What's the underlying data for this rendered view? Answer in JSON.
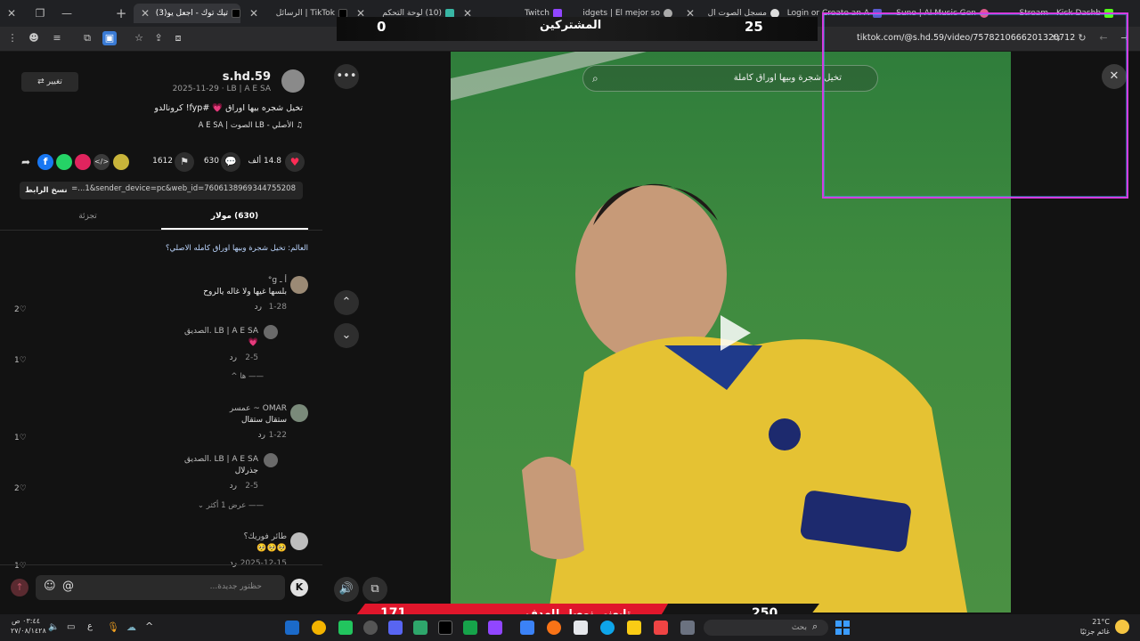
{
  "browser": {
    "tabs": [
      {
        "label": "تيك توك - اجعل يو(3)",
        "active": true
      },
      {
        "label": "TikTok | الرسائل"
      },
      {
        "label": "(10) لوحة التحكم"
      },
      {
        "label": "Twitch"
      },
      {
        "label": "Widgets | El mejor so"
      },
      {
        "label": "مسجل الصوت ال"
      },
      {
        "label": "Login or Create an A"
      },
      {
        "label": "Suno | AI Music Gen"
      },
      {
        "label": "Stream - Kick Dashb"
      }
    ],
    "url": "tiktok.com/@s.hd.59/video/7578210666201320712"
  },
  "overlay": {
    "subscribers_label": "المشتركين",
    "left_count": "0",
    "right_count": "25",
    "goal_label": "تابعني نوصل للهدف",
    "goal_current": "171",
    "goal_target": "250"
  },
  "post": {
    "username": "s.hd.59",
    "meta": "2025-11-29 · LB | A E SA",
    "caption": "تخيل شجره بيها اوراق 💗 #fyp! كرونالدو",
    "sound": "الأصلي - LB الصوت | A E SA",
    "edit_label": "تغيير",
    "likes": "14.8 ألف",
    "comments_count": "630",
    "bookmarks": "1612",
    "link": "=...1&sender_device=pc&web_id=7606138969344755208",
    "copy_link_label": "نسخ الرابط",
    "tab_comments": "(630) مولار",
    "tab_creator": "تجزئة",
    "search_suggestion": "العالم: تخيل شجرة وبيها اوراق كامله الاصلي؟"
  },
  "comments": [
    {
      "name": "أ ـ g°",
      "text": "بلسها غيها ولا غاله يالروح",
      "date": "1-28",
      "likes": "2",
      "reply": "رد"
    },
    {
      "name": "LB | A E SA .الصديق",
      "text": "💗",
      "date": "2-5",
      "likes": "1",
      "reply": "رد"
    },
    {
      "name": "OMAR ~ عمسر",
      "text": "ستقال ستقال",
      "date": "1-22",
      "likes": "1",
      "reply": "رد"
    },
    {
      "name": "LB | A E SA .الصديق",
      "text": "جذرلال",
      "date": "2-5",
      "likes": "2",
      "reply": "رد"
    },
    {
      "name": "طائر فوريك؟",
      "text": "🥺🥺🥺",
      "date": "2025-12-15",
      "likes": "1",
      "reply": "رد"
    }
  ],
  "view_replies_label": "ها",
  "view_more_label": "عرض 1 أكثر",
  "comment_input_placeholder": "حظتور جديدة...",
  "video": {
    "search_placeholder": "تخيل شجرة وبيها اوراق كاملة"
  },
  "taskbar": {
    "search_label": "بحث",
    "time": "٠٣:٤٤ ص",
    "date": "٢٧/٠٨/١٤٢٨",
    "weather_temp": "21°C",
    "weather_desc": "غائم جزئيًا",
    "lang": "ع"
  },
  "colors": {
    "accent_red": "#e0162b",
    "pink_frame": "#d63ce0",
    "like_red": "#fe2c55"
  }
}
